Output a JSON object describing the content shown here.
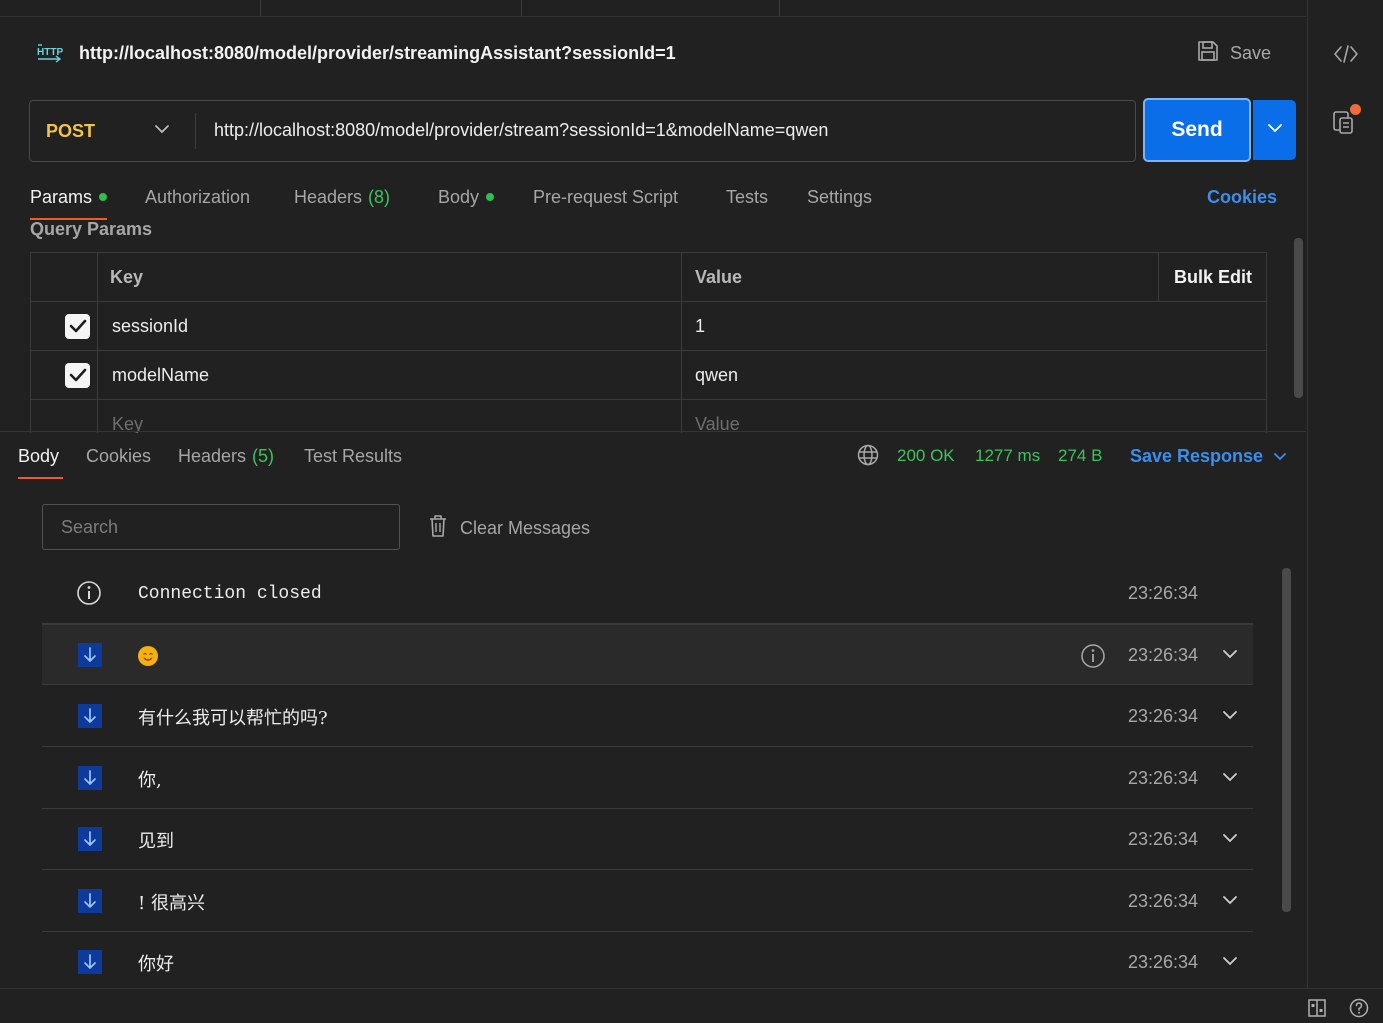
{
  "request": {
    "title": "http://localhost:8080/model/provider/streamingAssistant?sessionId=1",
    "save_label": "Save",
    "method": "POST",
    "url": "http://localhost:8080/model/provider/stream?sessionId=1&modelName=qwen",
    "send_label": "Send",
    "tabs": {
      "params": "Params",
      "authorization": "Authorization",
      "headers": "Headers",
      "headers_count": "(8)",
      "body": "Body",
      "prerequest": "Pre-request Script",
      "tests": "Tests",
      "settings": "Settings",
      "cookies": "Cookies"
    },
    "query_params_label": "Query Params",
    "params_table": {
      "header_key": "Key",
      "header_value": "Value",
      "bulk_edit": "Bulk Edit",
      "rows": [
        {
          "key": "sessionId",
          "value": "1",
          "checked": true
        },
        {
          "key": "modelName",
          "value": "qwen",
          "checked": true
        }
      ],
      "placeholder_key": "Key",
      "placeholder_value": "Value"
    }
  },
  "response": {
    "tabs": {
      "body": "Body",
      "cookies": "Cookies",
      "headers": "Headers",
      "headers_count": "(5)",
      "test_results": "Test Results"
    },
    "status": "200 OK",
    "time": "1277 ms",
    "size": "274 B",
    "save_response": "Save Response",
    "search_placeholder": "Search",
    "clear_messages": "Clear Messages",
    "messages": [
      {
        "type": "info",
        "text": "Connection closed",
        "time": "23:26:34"
      },
      {
        "type": "received",
        "text": "",
        "emoji": "smile",
        "time": "23:26:34",
        "highlighted": true
      },
      {
        "type": "received",
        "text": "有什么我可以帮忙的吗?",
        "time": "23:26:34"
      },
      {
        "type": "received",
        "text": "你,",
        "time": "23:26:34"
      },
      {
        "type": "received",
        "text": "见到",
        "time": "23:26:34"
      },
      {
        "type": "received",
        "text": "! 很高兴",
        "time": "23:26:34"
      },
      {
        "type": "received",
        "text": "你好",
        "time": "23:26:34"
      }
    ]
  },
  "colors": {
    "background": "#212121",
    "accent_blue": "#0b6ee9",
    "link_blue": "#3b8eed",
    "status_green": "#3cc35a",
    "method_yellow": "#f3c344",
    "tab_underline": "#ef5b25",
    "notification_dot": "#f26b3a"
  }
}
